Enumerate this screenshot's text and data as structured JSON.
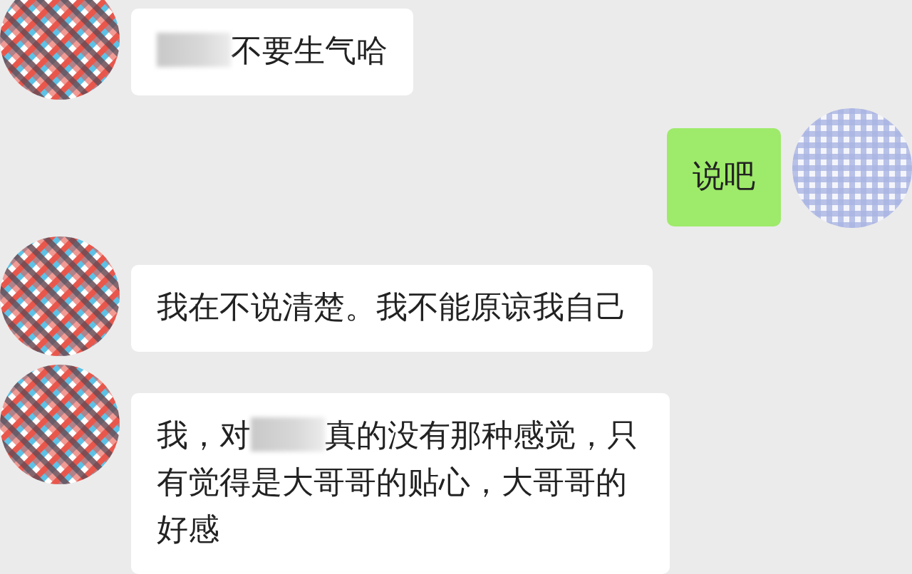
{
  "messages": [
    {
      "outgoing": false,
      "parts": [
        {
          "kind": "redacted"
        },
        {
          "kind": "text",
          "text": "不要生气哈"
        }
      ]
    },
    {
      "outgoing": true,
      "parts": [
        {
          "kind": "text",
          "text": "说吧"
        }
      ]
    },
    {
      "outgoing": false,
      "parts": [
        {
          "kind": "text",
          "text": "我在不说清楚。我不能原谅我自己"
        }
      ]
    },
    {
      "outgoing": false,
      "parts": [
        {
          "kind": "text",
          "text": "我，对"
        },
        {
          "kind": "redacted"
        },
        {
          "kind": "text",
          "text": "真的没有那种感觉，只有觉得是大哥哥的贴心，大哥哥的好感"
        }
      ]
    }
  ]
}
